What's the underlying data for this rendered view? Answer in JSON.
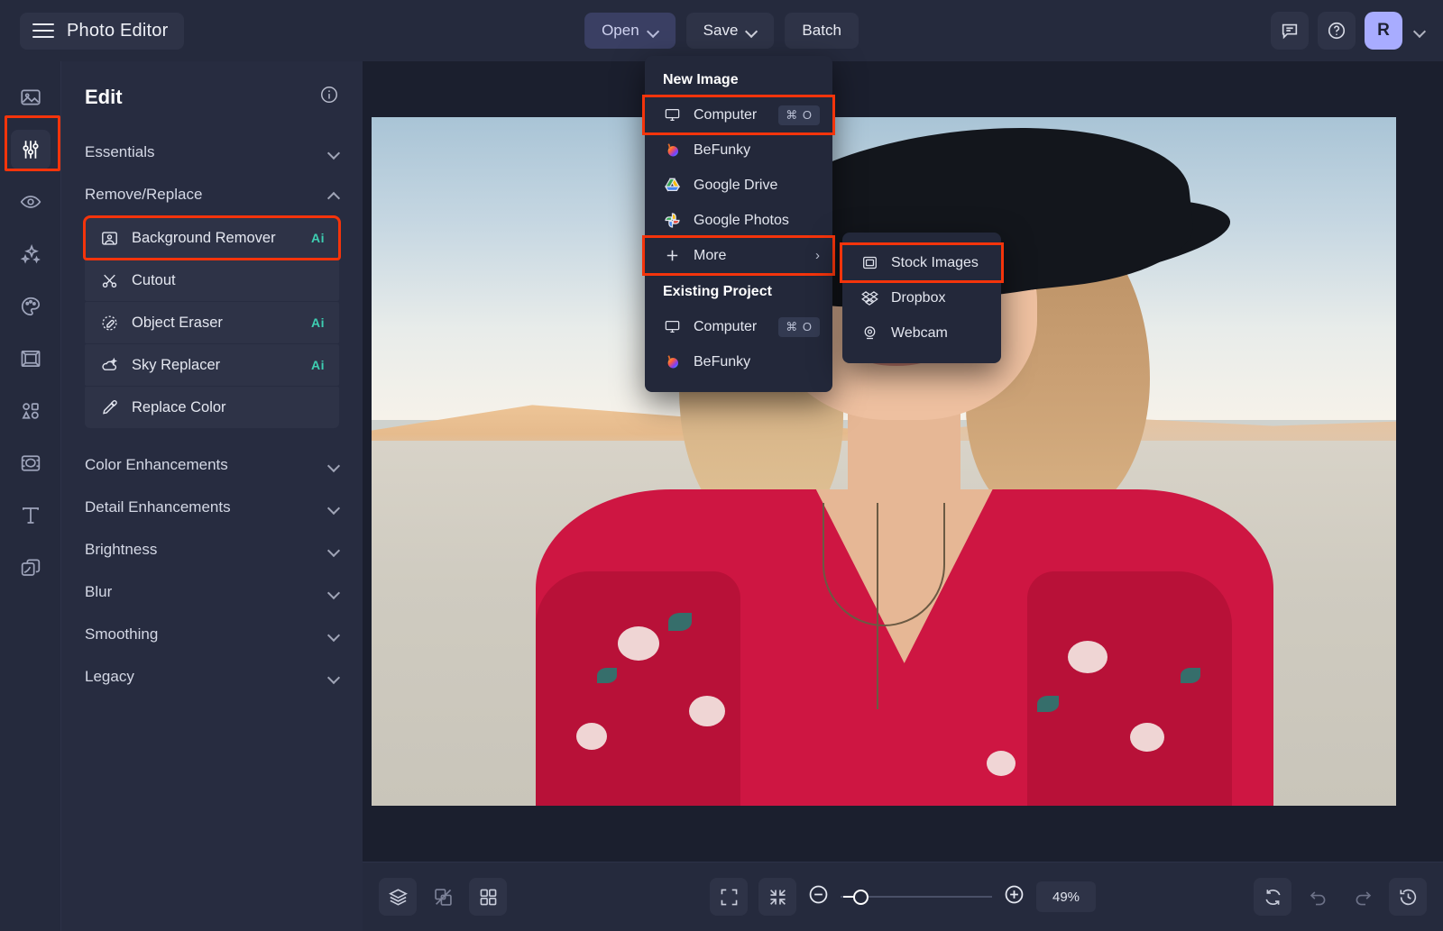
{
  "app": {
    "title": "Photo Editor",
    "accent_red": "#f4340b",
    "accent_purple": "#a8acff",
    "ai_badge_color": "#3ecfb2",
    "bg_dark": "#252a3d",
    "panel_bg": "#272c40",
    "canvas_bg": "#1b1f2e"
  },
  "topbar": {
    "menu_icon": "hamburger-icon",
    "open_label": "Open",
    "save_label": "Save",
    "batch_label": "Batch",
    "feedback_icon": "comment-icon",
    "help_icon": "question-circle-icon",
    "avatar_initial": "R",
    "avatar_chevron": "chevron-down-icon"
  },
  "rail": {
    "items": [
      {
        "name": "image-icon",
        "active": false
      },
      {
        "name": "adjust-sliders-icon",
        "active": true
      },
      {
        "name": "eye-retouch-icon",
        "active": false
      },
      {
        "name": "sparkles-effects-icon",
        "active": false
      },
      {
        "name": "palette-artsy-icon",
        "active": false
      },
      {
        "name": "frame-icon",
        "active": false
      },
      {
        "name": "shapes-graphics-icon",
        "active": false
      },
      {
        "name": "texture-overlay-icon",
        "active": false
      },
      {
        "name": "text-icon",
        "active": false
      },
      {
        "name": "layers-icon",
        "active": false
      }
    ]
  },
  "panel": {
    "title": "Edit",
    "info_icon": "info-circle-icon",
    "groups": [
      {
        "label": "Essentials",
        "expanded": false
      },
      {
        "label": "Remove/Replace",
        "expanded": true
      },
      {
        "label": "Color Enhancements",
        "expanded": false
      },
      {
        "label": "Detail Enhancements",
        "expanded": false
      },
      {
        "label": "Brightness",
        "expanded": false
      },
      {
        "label": "Blur",
        "expanded": false
      },
      {
        "label": "Smoothing",
        "expanded": false
      },
      {
        "label": "Legacy",
        "expanded": false
      }
    ],
    "tools": [
      {
        "label": "Background Remover",
        "icon": "person-photo-icon",
        "badge": "Ai",
        "highlighted": true
      },
      {
        "label": "Cutout",
        "icon": "scissors-icon",
        "badge": "",
        "highlighted": false
      },
      {
        "label": "Object Eraser",
        "icon": "eraser-icon",
        "badge": "Ai",
        "highlighted": false
      },
      {
        "label": "Sky Replacer",
        "icon": "cloud-sparkle-icon",
        "badge": "Ai",
        "highlighted": false
      },
      {
        "label": "Replace Color",
        "icon": "eyedropper-icon",
        "badge": "",
        "highlighted": false
      }
    ]
  },
  "open_menu": {
    "section_new": "New Image",
    "section_existing": "Existing Project",
    "new_items": [
      {
        "label": "Computer",
        "icon": "desktop-icon",
        "shortcut": "⌘ O",
        "highlighted": true,
        "has_submenu": false
      },
      {
        "label": "BeFunky",
        "icon": "befunky-logo-icon",
        "shortcut": "",
        "highlighted": false,
        "has_submenu": false
      },
      {
        "label": "Google Drive",
        "icon": "google-drive-logo-icon",
        "shortcut": "",
        "highlighted": false,
        "has_submenu": false
      },
      {
        "label": "Google Photos",
        "icon": "google-photos-logo-icon",
        "shortcut": "",
        "highlighted": false,
        "has_submenu": false
      },
      {
        "label": "More",
        "icon": "plus-icon",
        "shortcut": "",
        "highlighted": true,
        "has_submenu": true
      }
    ],
    "existing_items": [
      {
        "label": "Computer",
        "icon": "desktop-icon",
        "shortcut": "⌘ O",
        "highlighted": false,
        "has_submenu": false
      },
      {
        "label": "BeFunky",
        "icon": "befunky-logo-icon",
        "shortcut": "",
        "highlighted": false,
        "has_submenu": false
      }
    ],
    "submenu_arrow": "chevron-right-icon"
  },
  "more_submenu": {
    "items": [
      {
        "label": "Stock Images",
        "icon": "stock-image-icon",
        "highlighted": true
      },
      {
        "label": "Dropbox",
        "icon": "dropbox-logo-icon",
        "highlighted": false
      },
      {
        "label": "Webcam",
        "icon": "webcam-icon",
        "highlighted": false
      }
    ]
  },
  "bottombar": {
    "left_tools": [
      {
        "name": "layers-icon",
        "active": true
      },
      {
        "name": "compare-split-icon",
        "active": false
      },
      {
        "name": "grid-view-icon",
        "active": true
      }
    ],
    "fit_icon": "expand-fullscreen-icon",
    "shrink_icon": "collapse-fit-icon",
    "zoom_out_icon": "minus-circle-icon",
    "zoom_in_icon": "plus-circle-icon",
    "zoom_value": "49%",
    "zoom_percent": 49,
    "slider_fill_ratio": 0.12,
    "right_tools": [
      {
        "name": "reset-rotate-icon",
        "active": true
      },
      {
        "name": "undo-icon",
        "active": false
      },
      {
        "name": "redo-icon",
        "active": false
      },
      {
        "name": "history-icon",
        "active": true
      }
    ]
  },
  "canvas": {
    "image_alt": "Portrait of a woman wearing a black wide-brim hat and a red floral dress standing in a desert",
    "zoom_label": "49%"
  }
}
